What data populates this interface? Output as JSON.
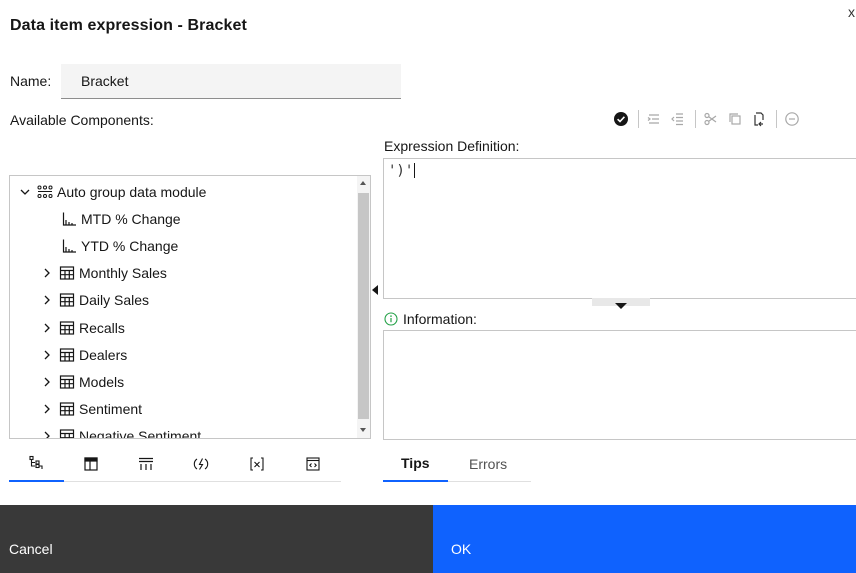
{
  "dialog": {
    "title": "Data item expression - Bracket",
    "close_glyph": "x"
  },
  "name_field": {
    "label": "Name:",
    "value": "Bracket"
  },
  "available_components": {
    "label": "Available Components:"
  },
  "toolbar": {
    "icons": [
      "validate-icon",
      "indent-icon",
      "outdent-icon",
      "cut-icon",
      "copy-icon",
      "paste-icon",
      "remove-icon"
    ]
  },
  "expression": {
    "label": "Expression Definition:",
    "text": "')'"
  },
  "information": {
    "label": "Information:"
  },
  "tree": {
    "items": [
      {
        "label": "Auto group data module",
        "level": 0,
        "expand": "expanded",
        "icon": "data-module-icon"
      },
      {
        "label": "MTD % Change",
        "level": 1,
        "expand": "none",
        "icon": "measure-icon"
      },
      {
        "label": "YTD % Change",
        "level": 1,
        "expand": "none",
        "icon": "measure-icon"
      },
      {
        "label": "Monthly Sales",
        "level": 1,
        "expand": "collapsed",
        "icon": "table-icon"
      },
      {
        "label": "Daily Sales",
        "level": 1,
        "expand": "collapsed",
        "icon": "table-icon"
      },
      {
        "label": "Recalls",
        "level": 1,
        "expand": "collapsed",
        "icon": "table-icon"
      },
      {
        "label": "Dealers",
        "level": 1,
        "expand": "collapsed",
        "icon": "table-icon"
      },
      {
        "label": "Models",
        "level": 1,
        "expand": "collapsed",
        "icon": "table-icon"
      },
      {
        "label": "Sentiment",
        "level": 1,
        "expand": "collapsed",
        "icon": "table-icon"
      },
      {
        "label": "Negative Sentiment",
        "level": 1,
        "expand": "collapsed",
        "icon": "table-icon"
      }
    ]
  },
  "component_tabs": {
    "icons": [
      "source-tree-icon",
      "data-items-icon",
      "query-items-icon",
      "functions-icon",
      "parameters-icon",
      "macros-icon"
    ],
    "active": 0
  },
  "info_tabs": {
    "tips": "Tips",
    "errors": "Errors",
    "active": "Tips"
  },
  "footer": {
    "cancel": "Cancel",
    "ok": "OK"
  },
  "colors": {
    "primary": "#0f62fe",
    "secondary": "#393939",
    "info_icon": "#24a148"
  }
}
